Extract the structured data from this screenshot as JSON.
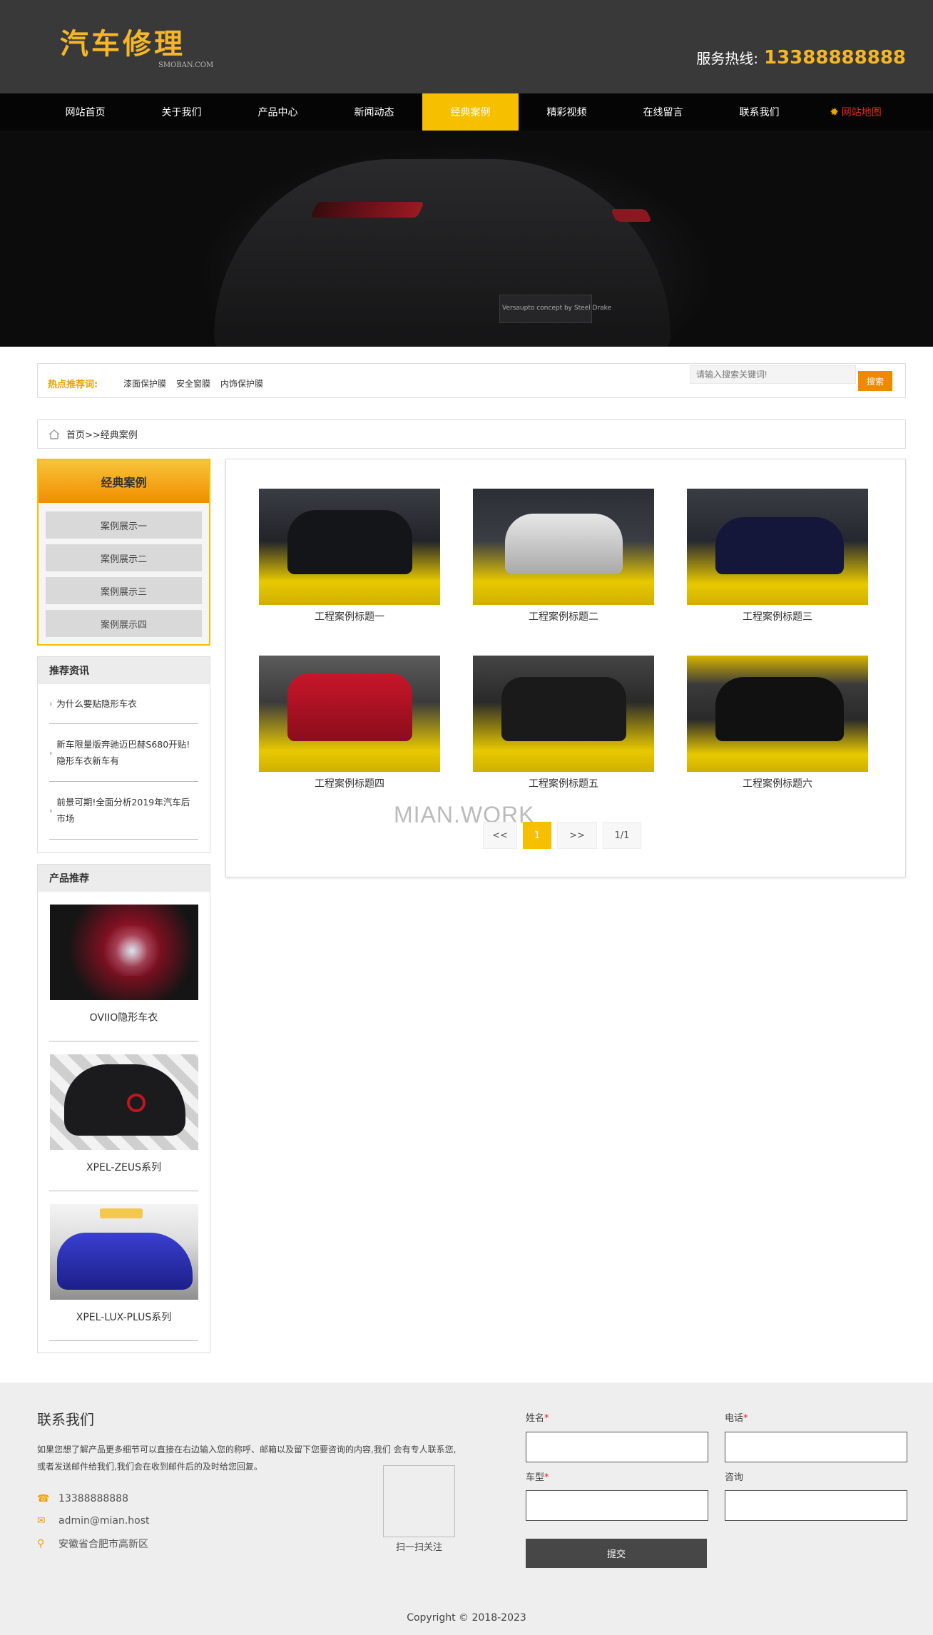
{
  "header": {
    "logo_text": "汽车修理",
    "logo_sub": "SMOBAN.COM",
    "hotline_label": "服务热线:",
    "hotline_number": "13388888888"
  },
  "nav": {
    "items": [
      "网站首页",
      "关于我们",
      "产品中心",
      "新闻动态",
      "经典案例",
      "精彩视频",
      "在线留言",
      "联系我们"
    ],
    "active_index": 4,
    "sitemap_label": "网站地图"
  },
  "banner": {
    "plate_text": "Versaupto concept by Steel Drake"
  },
  "hotbar": {
    "label": "热点推荐词:",
    "words": [
      "漆面保护膜",
      "安全窗膜",
      "内饰保护膜"
    ],
    "search_placeholder": "请输入搜索关键词!",
    "search_button": "搜索"
  },
  "breadcrumb": {
    "text": "首页>>经典案例"
  },
  "sidebar": {
    "case_menu_title": "经典案例",
    "case_menu_items": [
      "案例展示一",
      "案例展示二",
      "案例展示三",
      "案例展示四"
    ],
    "news_title": "推荐资讯",
    "news_items": [
      "为什么要贴隐形车衣",
      "新车限量版奔驰迈巴赫S680开贴!隐形车衣新车有",
      "前景可期!全面分析2019年汽车后市场"
    ],
    "products_title": "产品推荐",
    "products": [
      "OVIIO隐形车衣",
      "XPEL-ZEUS系列",
      "XPEL-LUX-PLUS系列"
    ]
  },
  "cases": {
    "items": [
      "工程案例标题一",
      "工程案例标题二",
      "工程案例标题三",
      "工程案例标题四",
      "工程案例标题五",
      "工程案例标题六"
    ],
    "watermark": "MIAN.WORK",
    "pager": {
      "prev": "<<",
      "current": "1",
      "next": ">>",
      "info": "1/1"
    }
  },
  "footer": {
    "title": "联系我们",
    "description": "如果您想了解产品更多细节可以直接在右边输入您的称呼、邮箱以及留下您要咨询的内容,我们 会有专人联系您,或者发送邮件给我们,我们会在收到邮件后的及时给您回复。",
    "phone": "13388888888",
    "email": "admin@mian.host",
    "address": "安徽省合肥市高新区",
    "qr_label": "扫一扫关注",
    "form": {
      "name_label": "姓名",
      "phone_label": "电话",
      "model_label": "车型",
      "inquiry_label": "咨询",
      "required_mark": "*",
      "submit": "提交"
    },
    "copyright": "Copyright © 2018-2023"
  },
  "colors": {
    "accent": "#f6c000",
    "brand_gold": "#f5b726",
    "search_orange": "#ef8a00",
    "header_bg": "#3a3939",
    "nav_bg": "#050505"
  }
}
